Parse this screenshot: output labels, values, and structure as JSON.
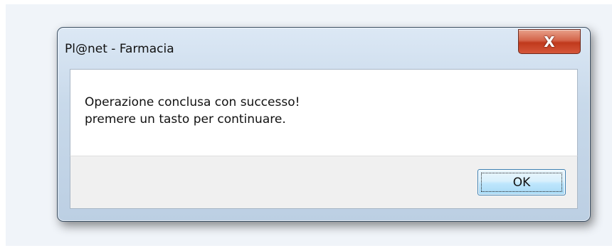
{
  "window": {
    "title": "Pl@net - Farmacia",
    "close_icon": "x-icon",
    "close_glyph": "X"
  },
  "message": {
    "line1": "Operazione conclusa con successo!",
    "line2": "premere un tasto per continuare."
  },
  "buttons": {
    "ok_label": "OK"
  },
  "colors": {
    "close_button": "#c7402a",
    "ok_border": "#3c7fb1",
    "frame": "#c8d9ea"
  }
}
